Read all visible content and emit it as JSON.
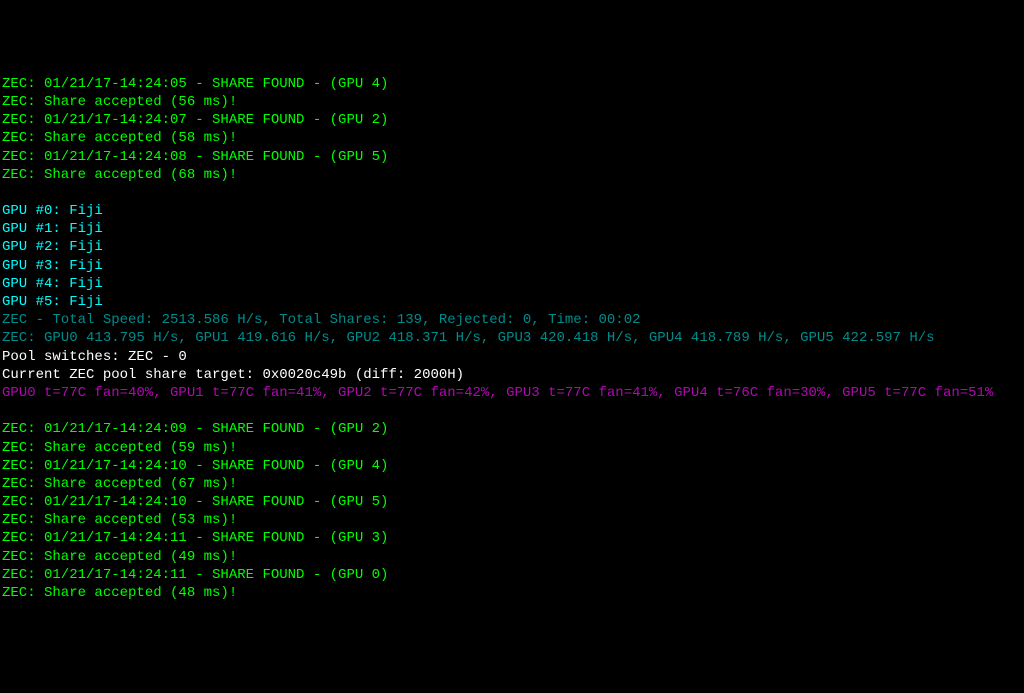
{
  "lines": [
    {
      "cls": "green-bright",
      "text": "ZEC: 01/21/17-14:24:05 - SHARE FOUND - (GPU 4)"
    },
    {
      "cls": "green-bright",
      "text": "ZEC: Share accepted (56 ms)!"
    },
    {
      "cls": "green-bright",
      "text": "ZEC: 01/21/17-14:24:07 - SHARE FOUND - (GPU 2)"
    },
    {
      "cls": "green-bright",
      "text": "ZEC: Share accepted (58 ms)!"
    },
    {
      "cls": "green-bright",
      "text": "ZEC: 01/21/17-14:24:08 - SHARE FOUND - (GPU 5)"
    },
    {
      "cls": "green-bright",
      "text": "ZEC: Share accepted (68 ms)!"
    },
    {
      "cls": "blank",
      "text": ""
    },
    {
      "cls": "cyan",
      "text": "GPU #0: Fiji"
    },
    {
      "cls": "cyan",
      "text": "GPU #1: Fiji"
    },
    {
      "cls": "cyan",
      "text": "GPU #2: Fiji"
    },
    {
      "cls": "cyan",
      "text": "GPU #3: Fiji"
    },
    {
      "cls": "cyan",
      "text": "GPU #4: Fiji"
    },
    {
      "cls": "cyan",
      "text": "GPU #5: Fiji"
    },
    {
      "cls": "teal",
      "text": "ZEC - Total Speed: 2513.586 H/s, Total Shares: 139, Rejected: 0, Time: 00:02"
    },
    {
      "cls": "teal",
      "text": "ZEC: GPU0 413.795 H/s, GPU1 419.616 H/s, GPU2 418.371 H/s, GPU3 420.418 H/s, GPU4 418.789 H/s, GPU5 422.597 H/s"
    },
    {
      "cls": "white",
      "text": "Pool switches: ZEC - 0"
    },
    {
      "cls": "white",
      "text": "Current ZEC pool share target: 0x0020c49b (diff: 2000H)"
    },
    {
      "cls": "magenta",
      "text": "GPU0 t=77C fan=40%, GPU1 t=77C fan=41%, GPU2 t=77C fan=42%, GPU3 t=77C fan=41%, GPU4 t=76C fan=30%, GPU5 t=77C fan=51%"
    },
    {
      "cls": "blank",
      "text": ""
    },
    {
      "cls": "green-bright",
      "text": "ZEC: 01/21/17-14:24:09 - SHARE FOUND - (GPU 2)"
    },
    {
      "cls": "green-bright",
      "text": "ZEC: Share accepted (59 ms)!"
    },
    {
      "cls": "green-bright",
      "text": "ZEC: 01/21/17-14:24:10 - SHARE FOUND - (GPU 4)"
    },
    {
      "cls": "green-bright",
      "text": "ZEC: Share accepted (67 ms)!"
    },
    {
      "cls": "green-bright",
      "text": "ZEC: 01/21/17-14:24:10 - SHARE FOUND - (GPU 5)"
    },
    {
      "cls": "green-bright",
      "text": "ZEC: Share accepted (53 ms)!"
    },
    {
      "cls": "green-bright",
      "text": "ZEC: 01/21/17-14:24:11 - SHARE FOUND - (GPU 3)"
    },
    {
      "cls": "green-bright",
      "text": "ZEC: Share accepted (49 ms)!"
    },
    {
      "cls": "green-bright",
      "text": "ZEC: 01/21/17-14:24:11 - SHARE FOUND - (GPU 0)"
    },
    {
      "cls": "green-bright",
      "text": "ZEC: Share accepted (48 ms)!"
    }
  ]
}
